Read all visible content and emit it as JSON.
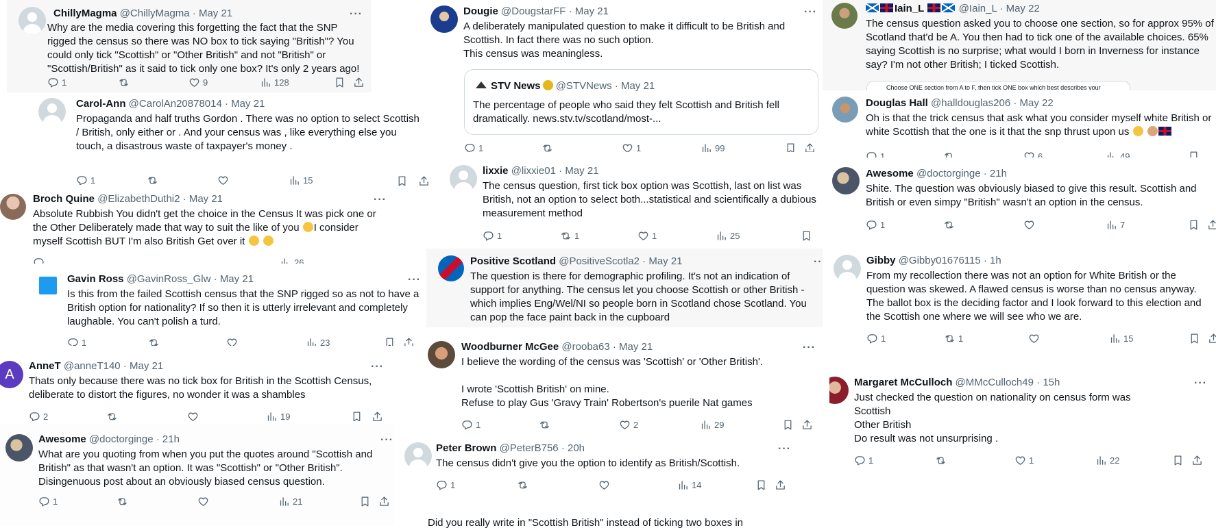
{
  "tweets": [
    {
      "name": "ChillyMagma",
      "handle": "@ChillyMagma",
      "date": "May 21",
      "text": "Why are the media covering this forgetting the fact that the SNP rigged the census so there was NO box to tick saying \"British\"? You could only tick \"Scottish\" or \"Other British\" and not \"British\" or \"Scottish/British\" as it said to tick only one box? It's only 2 years ago!",
      "replies": "1",
      "retweets": "",
      "likes": "9",
      "views": "128"
    },
    {
      "name": "Carol-Ann",
      "handle": "@CarolAn20878014",
      "date": "May 21",
      "text": "Propaganda and half truths Gordon . There was no option to select Scottish / British, only either or . And your census was , like everything else you touch, a disastrous waste of taxpayer's money .",
      "replies": "1",
      "retweets": "",
      "likes": "",
      "views": "15"
    },
    {
      "name": "Broch Quine",
      "handle": "@ElizabethDuthi2",
      "date": "May 21",
      "text": "Absolute Rubbish You didn't get the choice in the Census It was pick one or the Other Deliberately made that way  to suit the like of you",
      "text_b": "I consider myself Scottish BUT I'm also British Get over it",
      "replies": "",
      "retweets": "",
      "likes": "",
      "views": "26"
    },
    {
      "name": "Gavin Ross",
      "handle": "@GavinRoss_Glw",
      "date": "May 21",
      "text": "Is this from the failed Scottish census that the SNP rigged so as not to have a British option for nationality?  If so then it is utterly irrelevant and completely laughable.  You can't polish a turd.",
      "replies": "1",
      "retweets": "",
      "likes": "",
      "views": "23"
    },
    {
      "name": "AnneT",
      "handle": "@anneT140",
      "date": "May 21",
      "avatar_letter": "A",
      "text": "Thats only because there was no tick box for British in the Scottish Census, deliberate to distort the figures, no wonder it was a shambles",
      "replies": "2",
      "retweets": "",
      "likes": "",
      "views": "19"
    },
    {
      "name": "Awesome",
      "handle": "@doctorginge",
      "date": "21h",
      "text": "What are you quoting from when you put the quotes around \"Scottish and British\" as that wasn't an option.  It was \"Scottish\" or \"Other British\". Disingenuous post about an obviously biased census question.",
      "replies": "1",
      "retweets": "",
      "likes": "",
      "views": "21"
    },
    {
      "name": "Dougie",
      "handle": "@DougstarFF",
      "date": "May 21",
      "text": "A deliberately manipulated question to make it difficult to be British and Scottish. In fact there was no such option.\nThis census was meaningless.",
      "quote": {
        "name": "STV News",
        "handle": "@STVNews",
        "date": "May 21",
        "text": "The percentage of people who said they felt Scottish and British fell dramatically. news.stv.tv/scotland/most-..."
      },
      "replies": "1",
      "retweets": "",
      "likes": "1",
      "views": "99"
    },
    {
      "name": "lixxie",
      "handle": "@lixxie01",
      "date": "May 21",
      "text": "The census question, first tick box option was Scottish, last on list was British, not an option to select both...statistical and scientifically a dubious measurement method",
      "replies": "1",
      "retweets": "1",
      "likes": "1",
      "views": "25"
    },
    {
      "name": "Positive Scotland",
      "handle": "@PositiveScotla2",
      "date": "May 21",
      "text": "The question is there for demographic profiling. It's not an indication of support for anything. The census let you choose Scottish or other British - which implies Eng/Wel/NI so people born in Scotland chose Scotland. You can pop the face paint back in the cupboard",
      "replies": "",
      "retweets": "",
      "likes": "",
      "views": ""
    },
    {
      "name": "Woodburner McGee",
      "handle": "@rooba63",
      "date": "May 21",
      "text": "I believe the wording of the census was 'Scottish' or 'Other British'.\n\nI wrote 'Scottish British' on mine.\nRefuse to play Gus 'Gravy Train' Robertson's puerile Nat games",
      "replies": "1",
      "retweets": "",
      "likes": "2",
      "views": "29"
    },
    {
      "name": "Peter Brown",
      "handle": "@PeterB756",
      "date": "20h",
      "text": "The census didn't give you the option to identify as British/Scottish.",
      "replies": "1",
      "retweets": "",
      "likes": "",
      "views": "14"
    },
    {
      "name": "Iain_L",
      "handle": "@Iain_L",
      "date": "May 22",
      "text": "The census question asked you to choose one section, so for approx 95% of Scotland that'd be A. You then had to tick one of the available choices. 65% saying Scottish is no surprise; what would I born in Inverness for instance say? I'm not other British; I ticked Scottish.",
      "image_caption": "Choose ONE section from A to F, then tick ONE box which best describes your"
    },
    {
      "name": "Douglas Hall",
      "handle": "@halldouglas206",
      "date": "May 22",
      "text": "Oh is that the trick census that ask what you consider myself white British or white Scottish that the one is it that the snp thrust upon us",
      "replies": "1",
      "retweets": "",
      "likes": "6",
      "views": "49"
    },
    {
      "name": "Awesome",
      "handle": "@doctorginge",
      "date": "21h",
      "text": "Shite.  The question was obviously biased to give this result.  Scottish and British or even simpy \"British\" wasn't an option in the census.",
      "replies": "1",
      "retweets": "",
      "likes": "",
      "views": "7"
    },
    {
      "name": "Gibby",
      "handle": "@Gibby01676115",
      "date": "1h",
      "text": "From my recollection there was not an option for White British or the question was skewed. A flawed census is worse than no census anyway. The ballot box is the deciding factor and I look forward to this election and the Scottish one where we will see  who we are.",
      "replies": "1",
      "retweets": "1",
      "likes": "",
      "views": "15"
    },
    {
      "name": "Margaret McCulloch",
      "handle": "@MMcCulloch49",
      "date": "15h",
      "text": "Just checked the question on nationality on  census form was\nScottish\nOther British\nDo result was not unsurprising .",
      "replies": "1",
      "retweets": "",
      "likes": "1",
      "views": "22"
    }
  ],
  "fragment": {
    "text": "Did you really write in \"Scottish British\" instead of ticking two boxes in"
  },
  "ui": {
    "more_label": "···"
  },
  "icons": [
    "reply-icon",
    "retweet-icon",
    "like-icon",
    "views-icon",
    "bookmark-icon",
    "share-icon",
    "more-icon",
    "verified-badge-icon",
    "scottish-flag-icon",
    "union-flag-icon",
    "emoji-icon"
  ]
}
